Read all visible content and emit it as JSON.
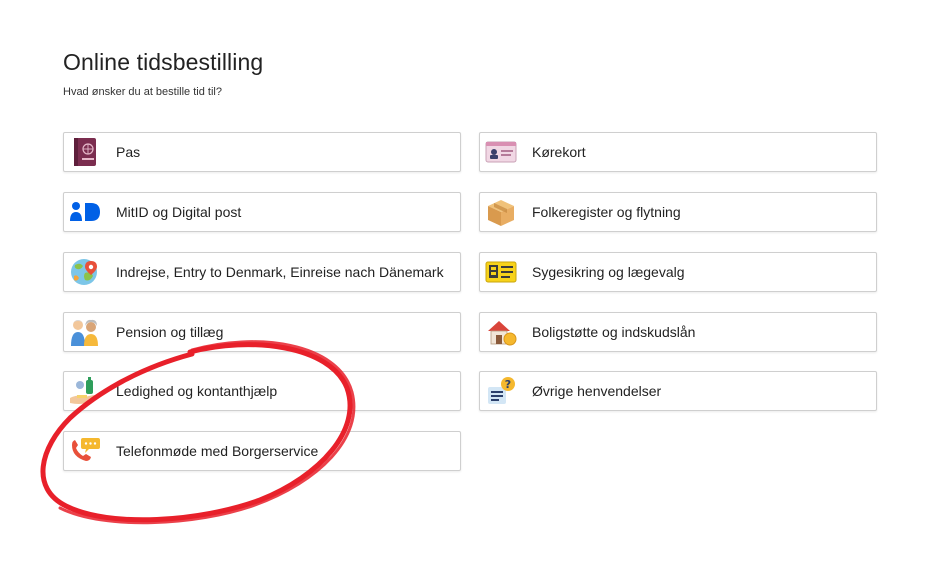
{
  "page": {
    "title": "Online tidsbestilling",
    "subtitle": "Hvad ønsker du at bestille tid til?"
  },
  "tiles": {
    "pas": {
      "label": "Pas",
      "icon": "passport-icon"
    },
    "korekort": {
      "label": "Kørekort",
      "icon": "drivers-license-icon"
    },
    "mitid": {
      "label": "MitID og Digital post",
      "icon": "mitid-logo-icon"
    },
    "folkeregister": {
      "label": "Folkeregister og flytning",
      "icon": "moving-box-icon"
    },
    "indrejse": {
      "label": "Indrejse, Entry to Denmark, Einreise nach Dänemark",
      "icon": "globe-location-icon"
    },
    "sygesikring": {
      "label": "Sygesikring og lægevalg",
      "icon": "health-card-icon"
    },
    "pension": {
      "label": "Pension og tillæg",
      "icon": "elderly-couple-icon"
    },
    "boligstotte": {
      "label": "Boligstøtte og indskudslån",
      "icon": "house-coin-icon"
    },
    "ledighed": {
      "label": "Ledighed og kontanthjælp",
      "icon": "hand-money-icon"
    },
    "ovrige": {
      "label": "Øvrige henvendelser",
      "icon": "question-document-icon"
    },
    "telefonmode": {
      "label": "Telefonmøde med Borgerservice",
      "icon": "phone-chat-icon"
    }
  },
  "colors": {
    "annotation_circle": "#e8202a",
    "tile_border": "#cfcfcf",
    "mitid_blue": "#0060e6"
  }
}
